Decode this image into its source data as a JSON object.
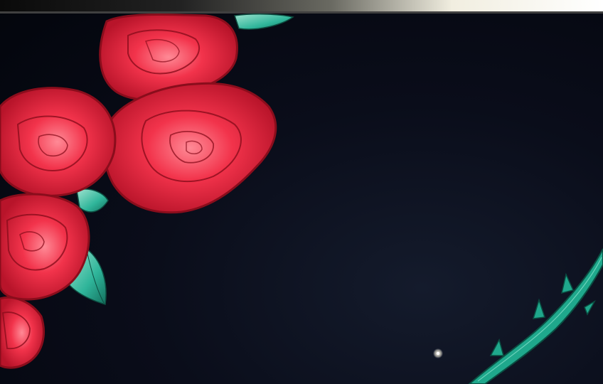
{
  "scene": {
    "subject": "",
    "palette": {
      "background": "#060912",
      "rose": "#e8213a",
      "rose_highlight": "#ff6b7d",
      "rose_outline": "#8a0d1c",
      "leaf": "#2fb59a",
      "thorn_stem": "#1fa88c",
      "star": "#ffffff"
    },
    "icons": [
      "rose-icon",
      "leaf-icon",
      "thorny-stem-icon",
      "star-icon"
    ]
  }
}
